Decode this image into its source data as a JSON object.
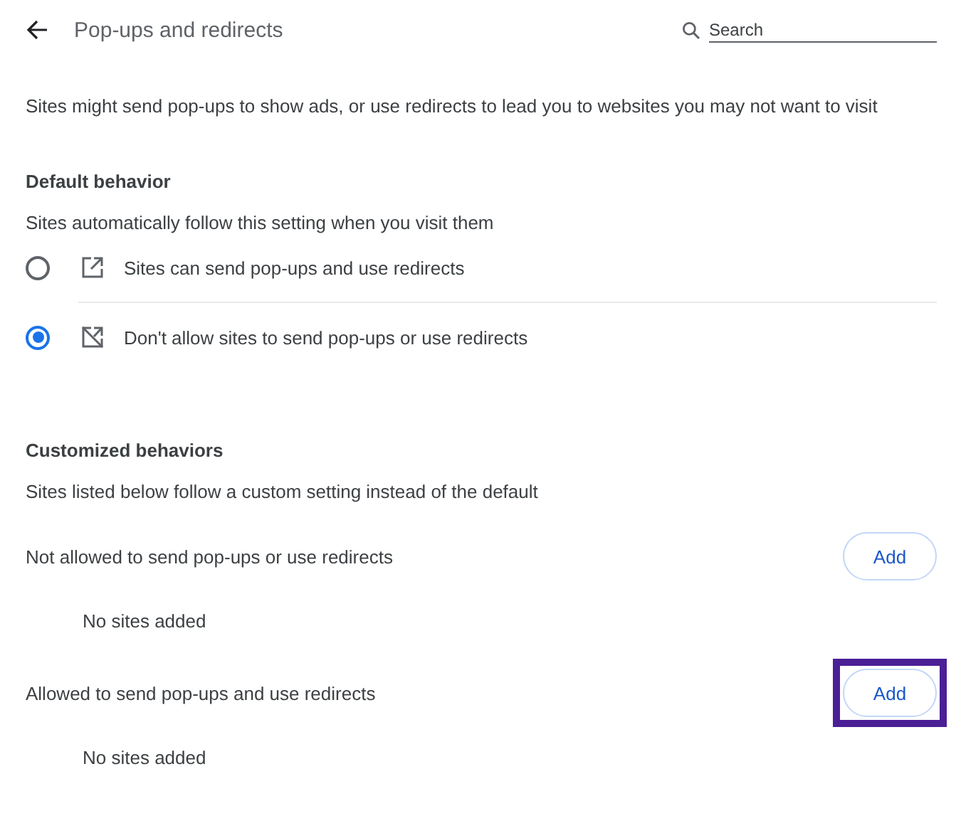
{
  "header": {
    "title": "Pop-ups and redirects",
    "search": {
      "placeholder": "Search"
    }
  },
  "description": "Sites might send pop-ups to show ads, or use redirects to lead you to websites you may not want to visit",
  "default_behavior": {
    "heading": "Default behavior",
    "subtitle": "Sites automatically follow this setting when you visit them",
    "options": [
      {
        "label": "Sites can send pop-ups and use redirects",
        "selected": false,
        "kind": "allow"
      },
      {
        "label": "Don't allow sites to send pop-ups or use redirects",
        "selected": true,
        "kind": "block"
      }
    ]
  },
  "customized": {
    "heading": "Customized behaviors",
    "subtitle": "Sites listed below follow a custom setting instead of the default",
    "lists": [
      {
        "label": "Not allowed to send pop-ups or use redirects",
        "button": "Add",
        "highlighted": false,
        "empty_text": "No sites added"
      },
      {
        "label": "Allowed to send pop-ups and use redirects",
        "button": "Add",
        "highlighted": true,
        "empty_text": "No sites added"
      }
    ]
  }
}
